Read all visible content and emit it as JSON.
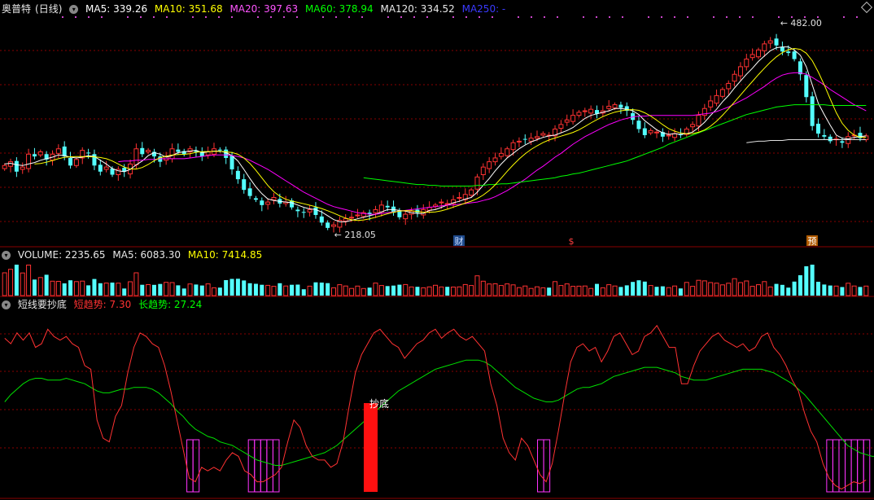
{
  "colors": {
    "up": "#ff3232",
    "down": "#54ffff",
    "ma5": "#ffffff",
    "ma10": "#ffff00",
    "ma20": "#ff00ff",
    "ma60": "#00ff00",
    "ma120": "#e0e0e0",
    "ma250": "#3333ff",
    "short": "#ff3232",
    "long": "#00e000",
    "grid": "#8a0000",
    "border": "#8a0000"
  },
  "price_panel": {
    "stock_name": "奥普特",
    "period": "(日线)",
    "ma5": "MA5: 339.26",
    "ma10": "MA10: 351.68",
    "ma20": "MA20: 397.63",
    "ma60": "MA60: 378.94",
    "ma120": "MA120: 334.52",
    "ma250": "MA250: -",
    "high_label": "482.00",
    "low_label": "218.05",
    "markers": [
      "财",
      "$",
      "预"
    ]
  },
  "volume_panel": {
    "title": "VOLUME: 2235.65",
    "ma5": "MA5: 6083.30",
    "ma10": "MA10: 7414.85"
  },
  "indicator_panel": {
    "title": "短线要抄底",
    "short_label": "短趋势: 7.30",
    "long_label": "长趋势: 27.24",
    "bottom_label": "抄底"
  },
  "chart_data": [
    {
      "type": "candlestick",
      "title": "奥普特 (日线)",
      "price_range": [
        218.05,
        482.0
      ],
      "annotations": [
        "482.00",
        "218.05"
      ],
      "close": [
        300,
        305,
        292,
        298,
        315,
        312,
        318,
        308,
        315,
        322,
        312,
        300,
        308,
        320,
        316,
        300,
        292,
        298,
        288,
        295,
        292,
        302,
        322,
        315,
        320,
        312,
        305,
        312,
        322,
        318,
        315,
        322,
        318,
        312,
        318,
        322,
        320,
        310,
        295,
        282,
        268,
        260,
        255,
        248,
        252,
        258,
        250,
        252,
        245,
        240,
        238,
        242,
        235,
        225,
        218,
        222,
        228,
        230,
        232,
        235,
        238,
        236,
        242,
        248,
        245,
        238,
        232,
        236,
        240,
        238,
        242,
        245,
        248,
        252,
        250,
        255,
        258,
        262,
        268,
        285,
        298,
        305,
        310,
        316,
        322,
        330,
        332,
        334,
        336,
        338,
        342,
        340,
        348,
        354,
        360,
        366,
        370,
        372,
        374,
        368,
        372,
        378,
        380,
        376,
        372,
        360,
        348,
        340,
        346,
        344,
        338,
        340,
        342,
        340,
        348,
        354,
        366,
        375,
        385,
        392,
        400,
        408,
        420,
        430,
        440,
        446,
        452,
        460,
        464,
        458,
        450,
        448,
        440,
        420,
        390,
        352,
        342,
        338,
        332,
        335,
        330,
        338,
        340,
        336,
        339
      ],
      "volume_scale": "relative",
      "ma5": [
        302,
        303,
        301,
        300,
        302,
        304,
        307,
        309,
        311,
        314,
        313,
        311,
        310,
        311,
        313,
        312,
        307,
        302,
        296,
        293,
        292,
        295,
        301,
        306,
        313,
        317,
        315,
        311,
        313,
        317,
        318,
        319,
        320,
        317,
        318,
        319,
        319,
        317,
        313,
        306,
        295,
        283,
        272,
        263,
        256,
        254,
        253,
        252,
        251,
        248,
        245,
        243,
        242,
        239,
        234,
        229,
        226,
        226,
        228,
        230,
        232,
        234,
        236,
        239,
        242,
        242,
        241,
        240,
        238,
        237,
        237,
        241,
        242,
        245,
        248,
        251,
        253,
        256,
        258,
        265,
        274,
        283,
        293,
        302,
        310,
        316,
        322,
        327,
        331,
        334,
        337,
        339,
        340,
        343,
        346,
        350,
        356,
        362,
        366,
        368,
        370,
        372,
        375,
        375,
        374,
        372,
        367,
        359,
        353,
        347,
        343,
        341,
        342,
        341,
        342,
        344,
        350,
        357,
        366,
        374,
        384,
        392,
        402,
        411,
        420,
        428,
        437,
        444,
        451,
        455,
        456,
        456,
        452,
        445,
        430,
        406,
        382,
        367,
        353,
        340,
        336,
        335,
        337,
        338,
        339
      ],
      "ma20": [
        null,
        null,
        null,
        null,
        null,
        null,
        null,
        null,
        null,
        null,
        null,
        null,
        null,
        null,
        null,
        null,
        null,
        null,
        null,
        305,
        306,
        306,
        307,
        307,
        308,
        308,
        309,
        309,
        309,
        309,
        309,
        310,
        311,
        312,
        313,
        314,
        314,
        314,
        313,
        312,
        310,
        307,
        303,
        299,
        295,
        290,
        285,
        280,
        275,
        270,
        265,
        261,
        257,
        253,
        249,
        246,
        244,
        242,
        240,
        238,
        237,
        236,
        236,
        237,
        238,
        239,
        240,
        241,
        242,
        243,
        244,
        245,
        246,
        247,
        248,
        248,
        249,
        250,
        251,
        252,
        254,
        256,
        259,
        263,
        267,
        272,
        277,
        282,
        288,
        294,
        299,
        305,
        311,
        316,
        322,
        328,
        333,
        338,
        342,
        346,
        350,
        354,
        357,
        360,
        362,
        364,
        365,
        365,
        366,
        366,
        366,
        366,
        366,
        366,
        366,
        366,
        367,
        368,
        369,
        371,
        374,
        377,
        381,
        385,
        389,
        394,
        399,
        404,
        410,
        415,
        419,
        421,
        422,
        422,
        420,
        416,
        411,
        406,
        400,
        395,
        390,
        385,
        380,
        376,
        372
      ],
      "ma60": [
        null,
        null,
        null,
        null,
        null,
        null,
        null,
        null,
        null,
        null,
        null,
        null,
        null,
        null,
        null,
        null,
        null,
        null,
        null,
        null,
        null,
        null,
        null,
        null,
        null,
        null,
        null,
        null,
        null,
        null,
        null,
        null,
        null,
        null,
        null,
        null,
        null,
        null,
        null,
        null,
        null,
        null,
        null,
        null,
        null,
        null,
        null,
        null,
        null,
        null,
        null,
        null,
        null,
        null,
        null,
        null,
        null,
        null,
        null,
        null,
        284,
        283,
        282,
        281,
        280,
        279,
        278,
        277,
        276,
        275,
        275,
        274,
        274,
        273,
        273,
        273,
        273,
        273,
        273,
        274,
        274,
        275,
        275,
        276,
        276,
        277,
        278,
        279,
        280,
        281,
        282,
        283,
        284,
        286,
        287,
        289,
        290,
        292,
        294,
        296,
        298,
        300,
        302,
        304,
        306,
        309,
        312,
        315,
        318,
        321,
        324,
        328,
        331,
        334,
        337,
        340,
        343,
        346,
        349,
        352,
        355,
        358,
        361,
        364,
        367,
        369,
        371,
        373,
        375,
        377,
        378,
        379,
        380,
        380,
        380,
        380,
        380,
        380,
        379,
        379,
        379,
        379,
        379,
        379,
        379
      ],
      "ma120": [
        null,
        null,
        null,
        null,
        null,
        null,
        null,
        null,
        null,
        null,
        null,
        null,
        null,
        null,
        null,
        null,
        null,
        null,
        null,
        null,
        null,
        null,
        null,
        null,
        null,
        null,
        null,
        null,
        null,
        null,
        null,
        null,
        null,
        null,
        null,
        null,
        null,
        null,
        null,
        null,
        null,
        null,
        null,
        null,
        null,
        null,
        null,
        null,
        null,
        null,
        null,
        null,
        null,
        null,
        null,
        null,
        null,
        null,
        null,
        null,
        null,
        null,
        null,
        null,
        null,
        null,
        null,
        null,
        null,
        null,
        null,
        null,
        null,
        null,
        null,
        null,
        null,
        null,
        null,
        null,
        null,
        null,
        null,
        null,
        null,
        null,
        null,
        null,
        null,
        null,
        null,
        null,
        null,
        null,
        null,
        null,
        null,
        null,
        null,
        null,
        null,
        null,
        null,
        null,
        null,
        null,
        null,
        null,
        null,
        null,
        null,
        null,
        null,
        null,
        null,
        null,
        null,
        null,
        null,
        null,
        null,
        null,
        null,
        null,
        330,
        331,
        332,
        332,
        333,
        333,
        333,
        334,
        334,
        334,
        334,
        334,
        334,
        334,
        334,
        334,
        334,
        334,
        334,
        334,
        334
      ]
    },
    {
      "type": "area",
      "title": "短线要抄底",
      "ylim": [
        0,
        100
      ],
      "series": [
        {
          "name": "短趋势",
          "values": [
            85,
            82,
            88,
            84,
            88,
            80,
            82,
            90,
            86,
            84,
            86,
            82,
            80,
            70,
            68,
            40,
            30,
            28,
            42,
            48,
            66,
            80,
            88,
            86,
            82,
            80,
            70,
            56,
            40,
            24,
            8,
            6,
            14,
            12,
            14,
            12,
            18,
            22,
            20,
            12,
            10,
            6,
            6,
            8,
            10,
            14,
            28,
            40,
            36,
            26,
            20,
            18,
            18,
            14,
            16,
            28,
            48,
            66,
            76,
            82,
            88,
            90,
            86,
            82,
            80,
            74,
            78,
            82,
            84,
            88,
            90,
            85,
            88,
            90,
            86,
            84,
            86,
            82,
            78,
            60,
            48,
            30,
            22,
            18,
            30,
            26,
            18,
            10,
            6,
            16,
            34,
            54,
            72,
            80,
            82,
            78,
            80,
            72,
            78,
            86,
            88,
            82,
            76,
            78,
            86,
            88,
            92,
            86,
            80,
            80,
            60,
            60,
            70,
            78,
            82,
            86,
            88,
            84,
            82,
            80,
            82,
            78,
            80,
            86,
            88,
            80,
            76,
            70,
            62,
            56,
            44,
            34,
            28,
            16,
            8,
            4,
            2,
            4,
            6,
            5,
            7
          ]
        },
        {
          "name": "长趋势",
          "values": [
            50,
            54,
            57,
            60,
            62,
            63,
            63,
            62,
            62,
            62,
            63,
            62,
            61,
            60,
            58,
            56,
            55,
            55,
            56,
            57,
            57,
            58,
            58,
            58,
            57,
            55,
            52,
            49,
            45,
            42,
            38,
            35,
            33,
            31,
            30,
            28,
            27,
            26,
            24,
            22,
            20,
            18,
            17,
            16,
            15,
            15,
            16,
            17,
            18,
            19,
            20,
            21,
            22,
            24,
            26,
            29,
            32,
            35,
            38,
            41,
            44,
            47,
            50,
            53,
            56,
            58,
            60,
            62,
            64,
            66,
            68,
            69,
            70,
            71,
            72,
            73,
            73,
            73,
            72,
            70,
            67,
            64,
            61,
            58,
            56,
            54,
            52,
            51,
            50,
            50,
            51,
            53,
            55,
            57,
            58,
            58,
            59,
            60,
            62,
            64,
            65,
            66,
            67,
            68,
            69,
            69,
            69,
            68,
            67,
            66,
            64,
            63,
            62,
            62,
            62,
            63,
            64,
            65,
            66,
            67,
            68,
            68,
            68,
            68,
            67,
            66,
            64,
            62,
            60,
            57,
            54,
            50,
            46,
            42,
            38,
            34,
            30,
            26,
            24,
            22,
            21,
            20,
            20,
            20,
            20
          ]
        }
      ]
    }
  ]
}
